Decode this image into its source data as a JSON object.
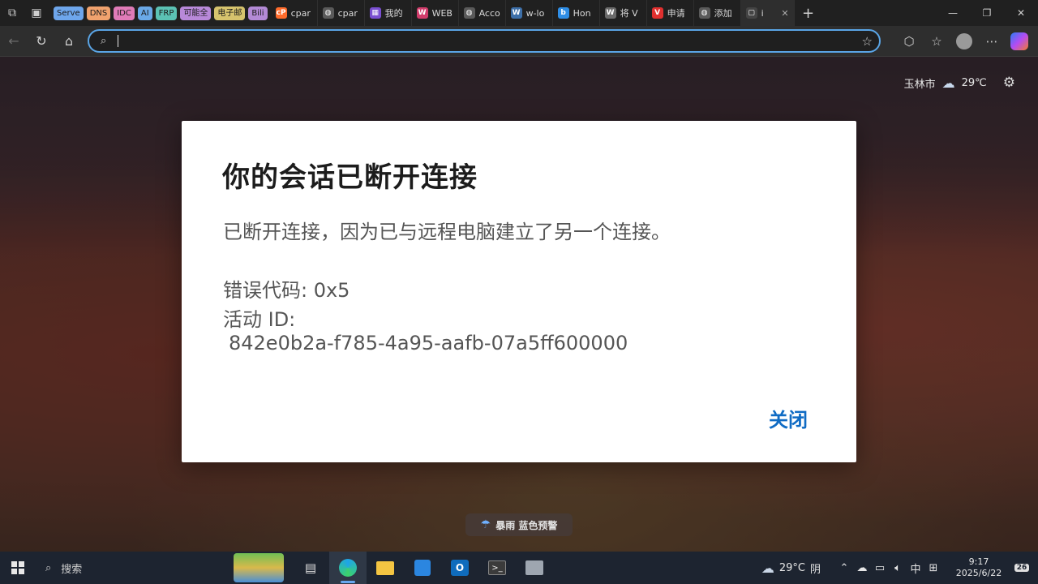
{
  "browser": {
    "tab_groups": [
      {
        "label": "Serve",
        "color": "#6ea6ec"
      },
      {
        "label": "DNS",
        "color": "#f0a26e"
      },
      {
        "label": "IDC",
        "color": "#e07bb8"
      },
      {
        "label": "AI",
        "color": "#6aa9e8"
      },
      {
        "label": "FRP",
        "color": "#5bc2b4"
      },
      {
        "label": "可能全",
        "color": "#b889d9"
      },
      {
        "label": "电子邮",
        "color": "#d6c36d"
      },
      {
        "label": "Bili",
        "color": "#b38ad6"
      }
    ],
    "tabs": [
      {
        "label": "cpar",
        "icon": "cpanel-icon",
        "color": "#ff6c2c"
      },
      {
        "label": "cpar",
        "icon": "globe-icon",
        "color": "#5a5a5a"
      },
      {
        "label": "我的",
        "icon": "app-icon",
        "color": "#7a4fd1"
      },
      {
        "label": "WEB",
        "icon": "web-icon",
        "color": "#d13c6b"
      },
      {
        "label": "Acco",
        "icon": "globe-icon",
        "color": "#5a5a5a"
      },
      {
        "label": "w-lo",
        "icon": "wordpress-icon",
        "color": "#3d6fa8"
      },
      {
        "label": "Hon",
        "icon": "bing-icon",
        "color": "#2f8ee6"
      },
      {
        "label": "将 V",
        "icon": "wordpress-icon",
        "color": "#6b6b6b"
      },
      {
        "label": "申请",
        "icon": "vivaldi-icon",
        "color": "#e0302f"
      },
      {
        "label": "添加",
        "icon": "globe-icon",
        "color": "#5a5a5a"
      }
    ],
    "active_tab_label": "i",
    "new_tab": "+",
    "address_value": ""
  },
  "weather": {
    "city": "玉林市",
    "temp": "29℃"
  },
  "alert": {
    "text": "暴雨 蓝色预警"
  },
  "dialog": {
    "title": "你的会话已断开连接",
    "message": "已断开连接，因为已与远程电脑建立了另一个连接。",
    "error_code": "错误代码: 0x5",
    "activity_label": "活动 ID:",
    "activity_id": "842e0b2a-f785-4a95-aafb-07a5ff600000",
    "close_label": "关闭"
  },
  "taskbar": {
    "search_placeholder": "搜索",
    "weather_temp": "29°C",
    "weather_cond": "阴",
    "ime": "中",
    "time": "9:17",
    "date": "2025/6/22",
    "notifications": "26"
  }
}
